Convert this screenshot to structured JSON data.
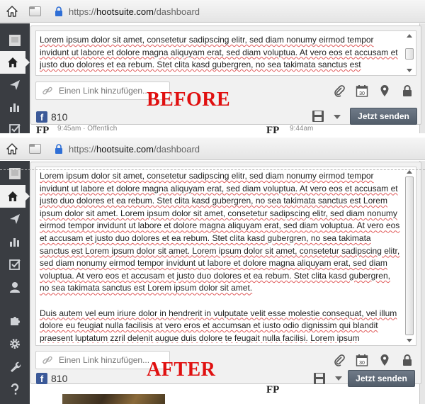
{
  "url": {
    "prefix": "https://",
    "host": "hootsuite.com",
    "path": "/dashboard"
  },
  "composer": {
    "text_before": "Lorem ipsum dolor sit amet, consetetur sadipscing elitr, sed diam nonumy eirmod tempor invidunt ut labore et dolore magna aliquyam erat, sed diam voluptua. At vero eos et accusam et justo duo dolores et ea rebum. Stet clita kasd gubergren, no sea takimata sanctus est",
    "text_after_p1": "Lorem ipsum dolor sit amet, consetetur sadipscing elitr, sed diam nonumy eirmod tempor invidunt ut labore et dolore magna aliquyam erat, sed diam voluptua. At vero eos et accusam et justo duo dolores et ea rebum. Stet clita kasd gubergren, no sea takimata sanctus est Lorem ipsum dolor sit amet. Lorem ipsum dolor sit amet, consetetur sadipscing elitr, sed diam nonumy eirmod tempor invidunt ut labore et dolore magna aliquyam erat, sed diam voluptua. At vero eos et accusam et justo duo dolores et ea rebum. Stet clita kasd gubergren, no sea takimata sanctus est Lorem ipsum dolor sit amet. Lorem ipsum dolor sit amet, consetetur sadipscing elitr, sed diam nonumy eirmod tempor invidunt ut labore et dolore magna aliquyam erat, sed diam voluptua. At vero eos et accusam et justo duo dolores et ea rebum. Stet clita kasd gubergren, no sea takimata sanctus est Lorem ipsum dolor sit amet.",
    "text_after_p2": "Duis autem vel eum iriure dolor in hendrerit in vulputate velit esse molestie consequat, vel illum dolore eu feugiat nulla facilisis at vero eros et accumsan et iusto odio dignissim qui blandit praesent luptatum zzril delenit augue duis dolore te feugait nulla facilisi. Lorem ipsum",
    "link_placeholder": "Einen Link hinzufügen...",
    "follower_count": "810",
    "send_label": "Jetzt senden",
    "calendar_day": "30"
  },
  "labels": {
    "before": "BEFORE",
    "after": "AFTER"
  },
  "below_before": {
    "fp_left": "FP",
    "meta_left": "9:45am · Öffentlich",
    "fp_right": "FP",
    "meta_right": "9:44am"
  },
  "below_after": {
    "fp_right": "FP"
  },
  "icons": {
    "home": "home-icon",
    "compose": "paper-plane-icon",
    "analytics": "bar-chart-icon",
    "assignments": "checkbox-icon",
    "contacts": "person-icon",
    "apps": "puzzle-icon",
    "settings": "gear-icon",
    "tools": "wrench-icon",
    "help": "question-icon",
    "link": "link-icon",
    "attach": "paperclip-icon",
    "calendar": "calendar-icon",
    "location": "map-pin-icon",
    "privacy": "lock-icon",
    "save": "floppy-disk-icon"
  },
  "colors": {
    "sidebar": "#3a3d42",
    "send_button": "#5d6875",
    "facebook": "#3b5998",
    "label": "#e01010"
  }
}
